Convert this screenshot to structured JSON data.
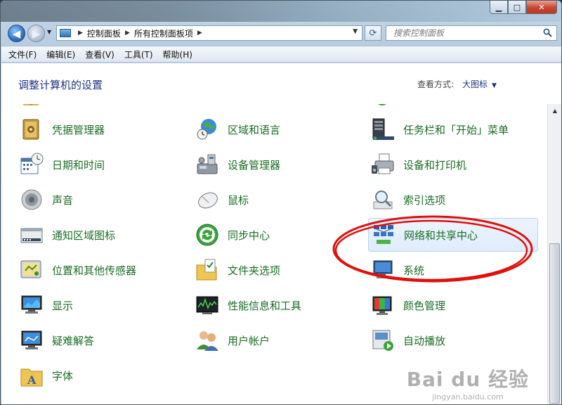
{
  "window": {
    "controls": {
      "minimize": "▁",
      "maximize": "□",
      "close": "✕"
    }
  },
  "nav": {
    "back_glyph": "◀",
    "forward_glyph": "▶",
    "breadcrumb": [
      "控制面板",
      "所有控制面板项"
    ],
    "search_placeholder": "搜索控制面板"
  },
  "menubar": [
    "文件(F)",
    "编辑(E)",
    "查看(V)",
    "工具(T)",
    "帮助(H)"
  ],
  "header": {
    "title": "调整计算机的设置",
    "view_by_label": "查看方式:",
    "view_by_value": "大图标"
  },
  "items": [
    {
      "label": "凭据管理器",
      "icon": "vault-icon"
    },
    {
      "label": "区域和语言",
      "icon": "globe-clock-icon"
    },
    {
      "label": "任务栏和「开始」菜单",
      "icon": "taskbar-icon"
    },
    {
      "label": "日期和时间",
      "icon": "calendar-clock-icon"
    },
    {
      "label": "设备管理器",
      "icon": "device-manager-icon"
    },
    {
      "label": "设备和打印机",
      "icon": "printer-icon"
    },
    {
      "label": "声音",
      "icon": "speaker-icon"
    },
    {
      "label": "鼠标",
      "icon": "mouse-icon"
    },
    {
      "label": "索引选项",
      "icon": "magnifier-icon"
    },
    {
      "label": "通知区域图标",
      "icon": "notification-icon"
    },
    {
      "label": "同步中心",
      "icon": "sync-icon"
    },
    {
      "label": "网络和共享中心",
      "icon": "network-icon"
    },
    {
      "label": "位置和其他传感器",
      "icon": "sensor-icon"
    },
    {
      "label": "文件夹选项",
      "icon": "folder-options-icon"
    },
    {
      "label": "系统",
      "icon": "system-icon"
    },
    {
      "label": "显示",
      "icon": "display-icon"
    },
    {
      "label": "性能信息和工具",
      "icon": "performance-icon"
    },
    {
      "label": "颜色管理",
      "icon": "color-management-icon"
    },
    {
      "label": "疑难解答",
      "icon": "troubleshoot-icon"
    },
    {
      "label": "用户帐户",
      "icon": "user-accounts-icon"
    },
    {
      "label": "自动播放",
      "icon": "autoplay-icon"
    },
    {
      "label": "字体",
      "icon": "fonts-icon"
    }
  ],
  "highlighted_item": "网络和共享中心",
  "annotation_color": "#e0100c",
  "label_color": "#1a6d24",
  "watermark": {
    "main": "Bai du 经验",
    "sub": "jingyan.baidu.com"
  }
}
